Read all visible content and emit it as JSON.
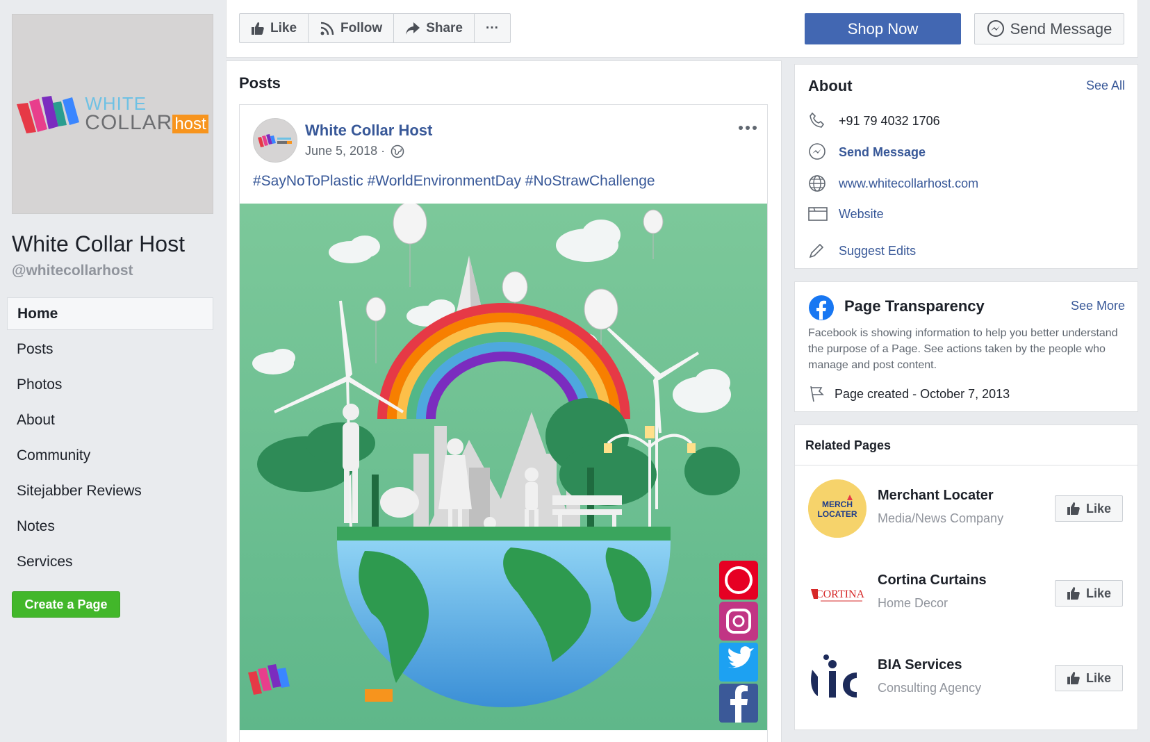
{
  "page": {
    "name": "White Collar Host",
    "handle": "@whitecollarhost",
    "logo_text": {
      "line1": "WHITE",
      "line2": "COLLAR",
      "host": "host"
    }
  },
  "nav": {
    "items": [
      {
        "label": "Home",
        "active": true
      },
      {
        "label": "Posts"
      },
      {
        "label": "Photos"
      },
      {
        "label": "About"
      },
      {
        "label": "Community"
      },
      {
        "label": "Sitejabber Reviews"
      },
      {
        "label": "Notes"
      },
      {
        "label": "Services"
      }
    ],
    "create_page_label": "Create a Page"
  },
  "actions": {
    "like": "Like",
    "follow": "Follow",
    "share": "Share",
    "more": "···",
    "shop_now": "Shop Now",
    "send_message": "Send Message"
  },
  "posts": {
    "title": "Posts",
    "post": {
      "author": "White Collar Host",
      "date": "June 5, 2018 ·",
      "text": "#SayNoToPlastic #WorldEnvironmentDay #NoStrawChallenge",
      "menu": "•••"
    }
  },
  "about": {
    "title": "About",
    "see_all": "See All",
    "phone": "+91 79 4032 1706",
    "send_message": "Send Message",
    "url": "www.whitecollarhost.com",
    "website": "Website",
    "suggest_edits": "Suggest Edits"
  },
  "transparency": {
    "title": "Page Transparency",
    "see_more": "See More",
    "description": "Facebook is showing information to help you better understand the purpose of a Page. See actions taken by the people who manage and post content.",
    "created": "Page created - October 7, 2013"
  },
  "related": {
    "title": "Related Pages",
    "like_label": "Like",
    "items": [
      {
        "name": "Merchant Locater",
        "category": "Media/News Company",
        "logo_text": "MERCHANT LOCATER"
      },
      {
        "name": "Cortina Curtains",
        "category": "Home Decor",
        "logo_text": "CORTINA"
      },
      {
        "name": "BIA Services",
        "category": "Consulting Agency",
        "logo_text": "bic"
      }
    ]
  },
  "colors": {
    "fb_blue": "#4267b2",
    "link": "#385898",
    "green_button": "#42b72a",
    "host_orange": "#f7941d"
  }
}
